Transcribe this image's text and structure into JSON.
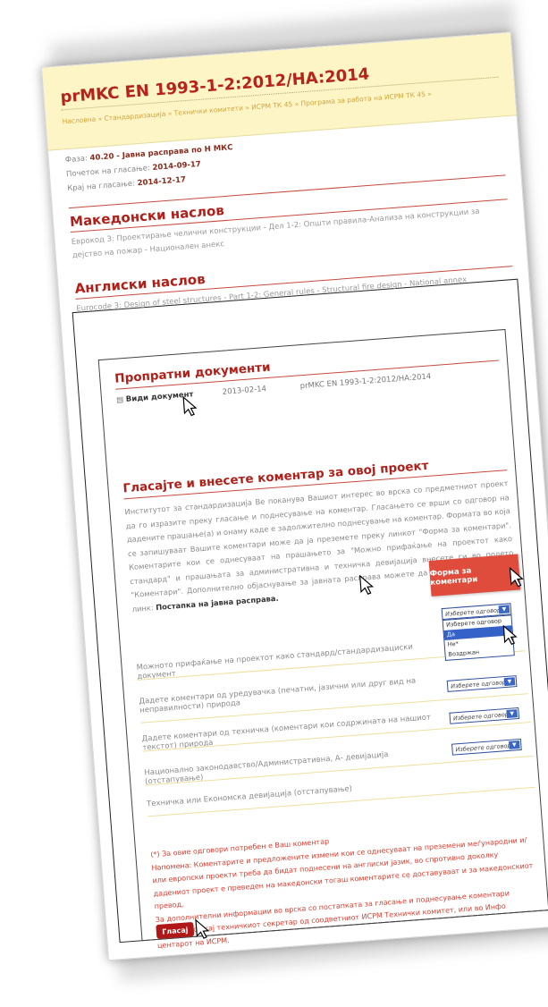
{
  "page": {
    "title": "prMKC EN 1993-1-2:2012/HA:2014",
    "breadcrumb": "Насловна » Стандардизација » Технички комитети » ИСРМ ТК 45 » Програма за работа на ИСРМ ТК 45 »"
  },
  "meta": {
    "phase_label": "Фаза:",
    "phase_value": "40.20 - Јавна расправа по Н МКС",
    "start_label": "Почеток на гласање:",
    "start_value": "2014-09-17",
    "end_label": "Крај на гласање:",
    "end_value": "2014-12-17"
  },
  "mk_title": {
    "heading": "Македонски наслов",
    "text": "Еврокод 3: Проектирање челични конструкции - Дел 1-2: Општи правила-Анализа на конструкции за дејство на пожар - Национален анекс"
  },
  "en_title": {
    "heading": "Англиски наслов",
    "text": "Eurocode 3: Design of steel structures - Part 1-2: General rules - Structural fire design - National annex"
  },
  "documents": {
    "heading": "Пропратни документи",
    "link_label": "Види документ",
    "date": "2013-02-14",
    "doc_name": "prMKC EN 1993-1-2:2012/HA:2014"
  },
  "vote": {
    "heading": "Гласајте и внесете коментар за овој проект",
    "paragraph": "Институтот за стандардизација Ве поканува Вашиот интерес во врска со предметниот проект да го изразите преку гласање и поднесување на коментар. Гласањето се врши со одговор на дадените прашање(а) и онаму каде е задолжително поднесување на коментар. Формата во која се запишуваат Вашите коментари може да ја преземете преку линкот \"Форма за коментари\". Коментарите кои се однесуваат на прашањето за \"Можно прифаќање на проектот како стандард\" и прашањата за административна и техничка девијација внесете ги во полето \"Коментари\". Дополнително објаснување за јавната расправа можете да најдете на следниот линк:",
    "link_text": "Постапка на јавна расправа.",
    "comment_form_button": "Форма за коментари"
  },
  "questions": [
    {
      "label": "Можното прифаќање на проектот како стандард/стандардизациски документ",
      "select": "Изберете одговор"
    },
    {
      "label": "Дадете коментари од уредувачка (печатни, јазични или друг вид на неправилности) природа",
      "select": "Изберете одговор"
    },
    {
      "label": "Дадете коментари од техничка (коментари кои содржината на нашиот текстот) природа",
      "select": "Изберете одговор"
    },
    {
      "label": "Национално законодавство/Административна, А- девијација (отстапување)",
      "select": "Изберете одговор"
    },
    {
      "label": "Техничка или Економска девијација (отстапување)",
      "select": ""
    }
  ],
  "dropdown_options": [
    "Изберете одговор",
    "Изберете одговор",
    "Да",
    "Не*",
    "Воздржан"
  ],
  "note": {
    "line1": "(*) За овие одговори потребен е Ваш коментар",
    "line2": "Напомена: Коментарите и предложените измени кои се однесуваат на преземени меѓународни и/или европски проекти треба да бидат поднесени на англиски јазик, во спротивно доколку дадениот проект е преведен на македонски тогаш коментарите се доставуваат и за македонскиот превод.",
    "line3": "За дополнителни информации во врска со постапката за гласање и поднесување коментари обратете се кај техничкиот секретар од соодветниот ИСРМ Технички комитет, или во Инфо центарот на ИСРМ."
  },
  "vote_button": "Гласај",
  "colors": {
    "accent_red": "#b01f18",
    "header_band": "#fdf5c5",
    "button_orange": "#e04c3b",
    "select_blue": "#3462c6"
  }
}
